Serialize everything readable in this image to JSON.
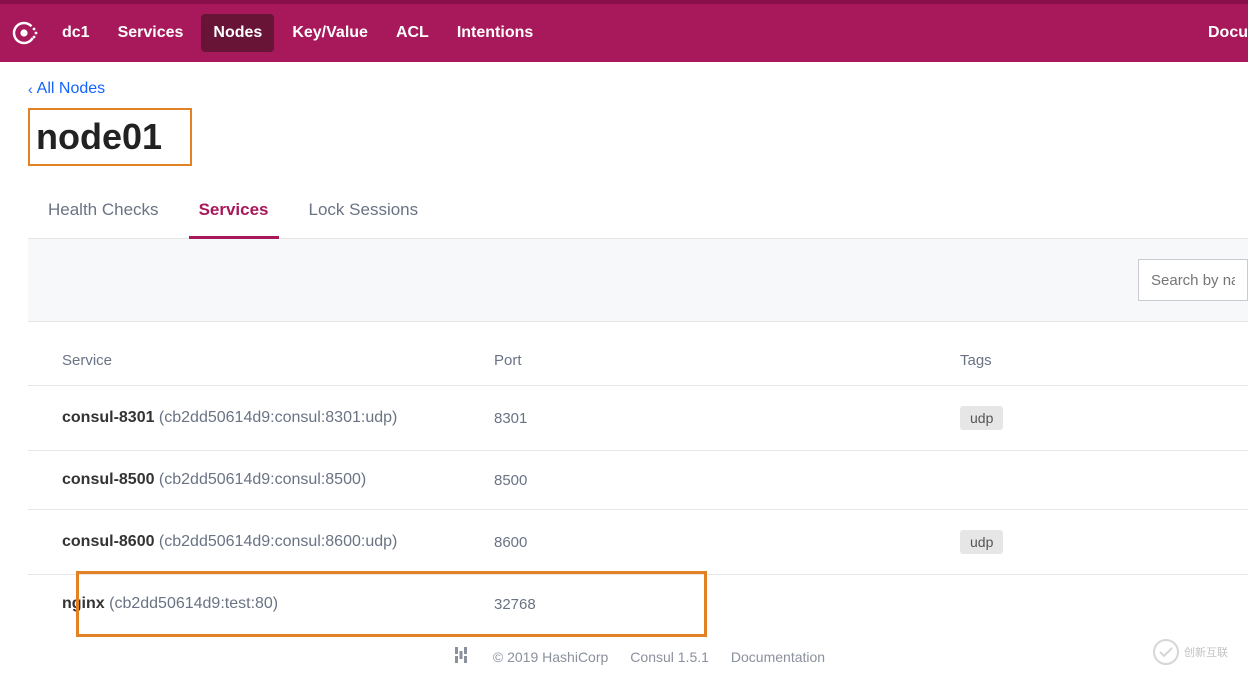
{
  "nav": {
    "datacenter": "dc1",
    "items": [
      "Services",
      "Nodes",
      "Key/Value",
      "ACL",
      "Intentions"
    ],
    "active_index": 1,
    "right_label": "Docu"
  },
  "breadcrumb": {
    "parent": "All Nodes"
  },
  "page": {
    "title": "node01"
  },
  "tabs": {
    "items": [
      "Health Checks",
      "Services",
      "Lock Sessions"
    ],
    "active_index": 1
  },
  "search": {
    "placeholder": "Search by na"
  },
  "table": {
    "columns": [
      "Service",
      "Port",
      "Tags"
    ],
    "rows": [
      {
        "name": "consul-8301",
        "detail": "(cb2dd50614d9:consul:8301:udp)",
        "port": "8301",
        "tags": [
          "udp"
        ],
        "highlight": false
      },
      {
        "name": "consul-8500",
        "detail": "(cb2dd50614d9:consul:8500)",
        "port": "8500",
        "tags": [],
        "highlight": false
      },
      {
        "name": "consul-8600",
        "detail": "(cb2dd50614d9:consul:8600:udp)",
        "port": "8600",
        "tags": [
          "udp"
        ],
        "highlight": false
      },
      {
        "name": "nginx",
        "detail": "(cb2dd50614d9:test:80)",
        "port": "32768",
        "tags": [],
        "highlight": true
      }
    ]
  },
  "footer": {
    "copyright": "© 2019 HashiCorp",
    "version": "Consul 1.5.1",
    "docs": "Documentation"
  },
  "watermark": {
    "text": "创新互联"
  }
}
